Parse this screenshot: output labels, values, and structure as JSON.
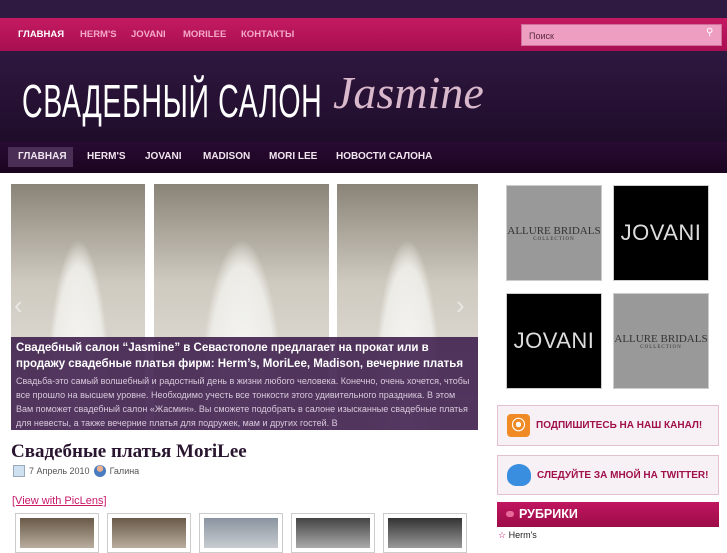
{
  "top_nav": {
    "items": [
      "ГЛАВНАЯ",
      "HERM'S",
      "JOVANI",
      "MORILEE",
      "КОНТАКТЫ"
    ],
    "search_placeholder": "Поиск"
  },
  "header": {
    "logo_text": "СВАДЕБНЫЙ САЛОН",
    "logo_script": "Jasmine"
  },
  "main_nav": {
    "items": [
      "ГЛАВНАЯ",
      "HERM'S",
      "JOVANI",
      "MADISON",
      "MORI LEE",
      "НОВОСТИ САЛОНА"
    ]
  },
  "slider": {
    "caption_title": "Свадебный салон “Jasmine” в Севастополе предлагает на прокат или в продажу свадебные платья фирм: Herm’s, MoriLee, Madison, вечерние платья",
    "caption_text": "Свадьба-это самый волшебный и радостный день в жизни любого человека. Конечно, очень хочется, чтобы все прошло на высшем уровне. Необходимо учесть все тонкости этого удивительного праздника. В этом Вам поможет свадебный салон «Жасмин». Вы сможете подобрать в салоне изысканные свадебные платья для невесты, а также вечерние платья для подружек, мам и других гостей. В",
    "prev": "‹",
    "next": "›"
  },
  "post": {
    "title": "Свадебные платья MoriLee",
    "date": "7 Апрель 2010",
    "author": "Галина",
    "piclens": "[View with PicLens]"
  },
  "sidebar": {
    "brands": [
      {
        "name": "ALLURE BRIDALS",
        "sub": "COLLECTION"
      },
      {
        "name": "JOVANI"
      },
      {
        "name": "JOVANI"
      },
      {
        "name": "ALLURE BRIDALS",
        "sub": "COLLECTION"
      }
    ],
    "rss": "ПОДПИШИТЕСЬ НА НАШ КАНАЛ!",
    "twitter": "СЛЕДУЙТЕ ЗА МНОЙ НА TWITTER!",
    "rubriki": "РУБРИКИ",
    "categories": [
      "Herm's"
    ]
  },
  "colors": {
    "accent": "#b8155a",
    "dark": "#2f1a42"
  }
}
